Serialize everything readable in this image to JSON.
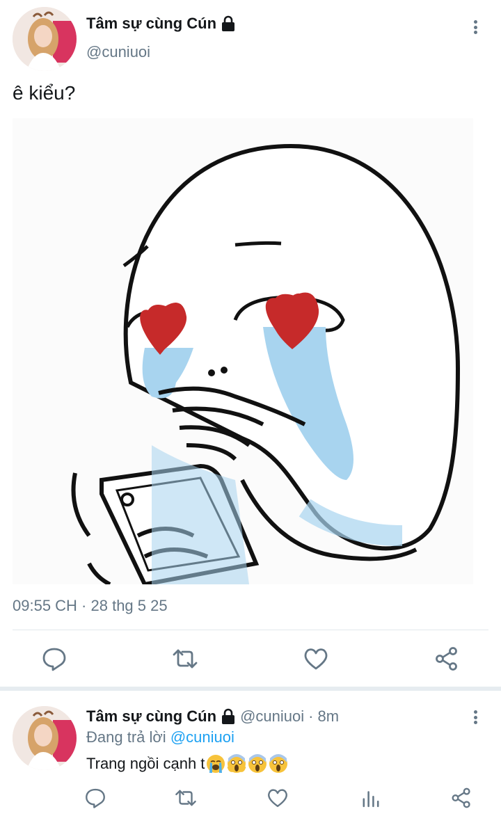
{
  "tweet": {
    "display_name": "Tâm sự cùng Cún",
    "handle": "@cuniuoi",
    "text": "ê kiểu?",
    "timestamp": "09:55 CH · 28 thg 5 25",
    "icons": {
      "lock": "lock-icon",
      "more": "more-vertical-icon",
      "reply": "reply-icon",
      "retweet": "retweet-icon",
      "like": "heart-icon",
      "share": "share-icon"
    }
  },
  "reply": {
    "display_name": "Tâm sự cùng Cún",
    "handle": "@cuniuoi",
    "separator": "·",
    "time_ago": "8m",
    "replying_prefix": "Đang trả lời",
    "replying_to": "@cuniuoi",
    "text": "Trang ngồi cạnh t",
    "emojis": [
      "loudly-crying-face",
      "screaming-face",
      "screaming-face",
      "screaming-face"
    ],
    "icons": {
      "reply": "reply-icon",
      "retweet": "retweet-icon",
      "like": "heart-icon",
      "analytics": "analytics-icon",
      "share": "share-icon"
    }
  },
  "colors": {
    "text_primary": "#14171a",
    "text_secondary": "#657786",
    "link": "#1da1f2",
    "divider": "#e1e8ed",
    "heart_red": "#c62a2a",
    "tear_blue": "#a8d4ef"
  }
}
